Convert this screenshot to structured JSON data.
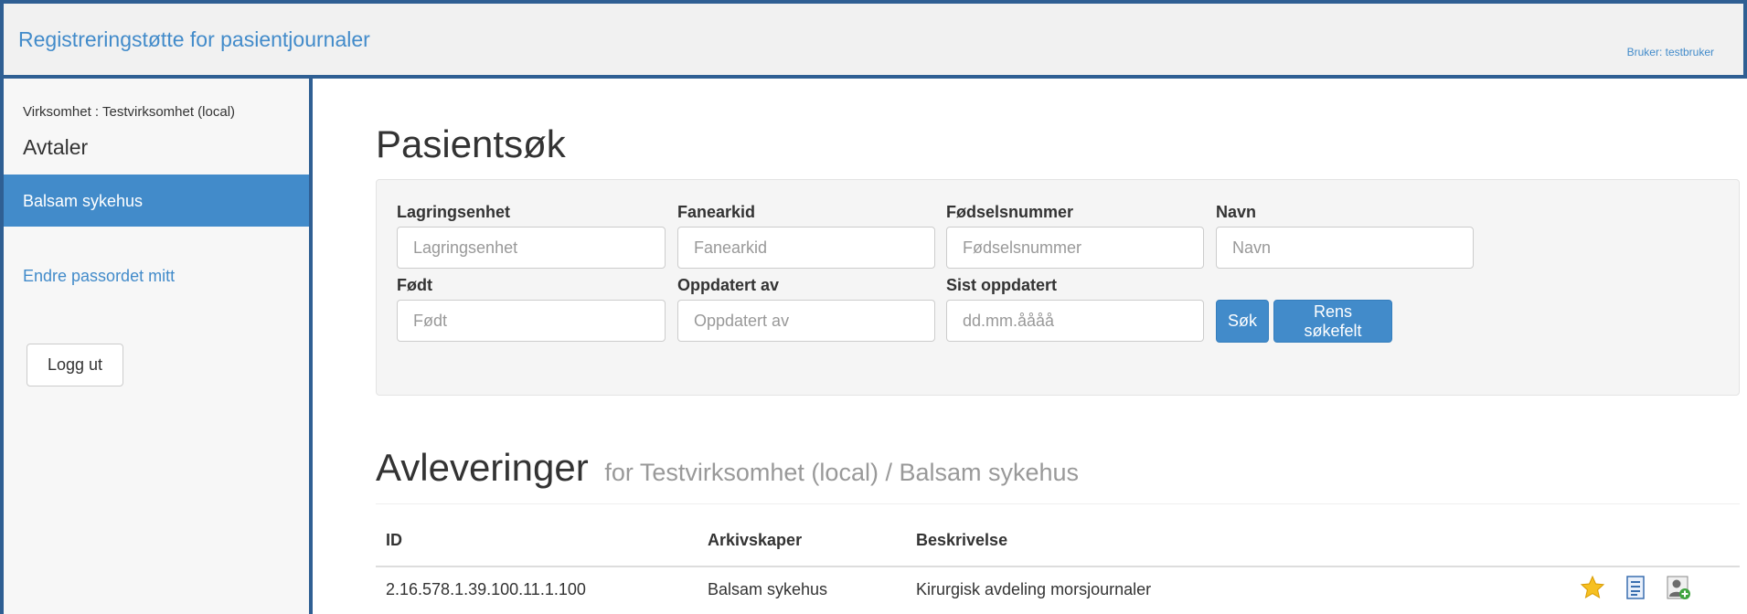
{
  "header": {
    "title": "Registreringstøtte for pasientjournaler",
    "user": "Bruker: testbruker"
  },
  "sidebar": {
    "org": "Virksomhet : Testvirksomhet (local)",
    "heading": "Avtaler",
    "active_item": "Balsam sykehus",
    "change_password": "Endre passordet mitt",
    "logout": "Logg ut"
  },
  "search": {
    "title": "Pasientsøk",
    "fields": {
      "lagringsenhet": {
        "label": "Lagringsenhet",
        "placeholder": "Lagringsenhet",
        "value": ""
      },
      "fanearkid": {
        "label": "Fanearkid",
        "placeholder": "Fanearkid",
        "value": ""
      },
      "fodselsnummer": {
        "label": "Fødselsnummer",
        "placeholder": "Fødselsnummer",
        "value": ""
      },
      "navn": {
        "label": "Navn",
        "placeholder": "Navn",
        "value": ""
      },
      "fodt": {
        "label": "Født",
        "placeholder": "Født",
        "value": ""
      },
      "oppdatert_av": {
        "label": "Oppdatert av",
        "placeholder": "Oppdatert av",
        "value": ""
      },
      "sist_oppdatert": {
        "label": "Sist oppdatert",
        "placeholder": "dd.mm.åååå",
        "value": ""
      }
    },
    "search_button": "Søk",
    "clear_button": "Rens søkefelt"
  },
  "deliveries": {
    "title": "Avleveringer",
    "subtitle": "for Testvirksomhet (local) / Balsam sykehus",
    "columns": [
      "ID",
      "Arkivskaper",
      "Beskrivelse"
    ],
    "rows": [
      {
        "id": "2.16.578.1.39.100.11.1.100",
        "arkivskaper": "Balsam sykehus",
        "beskrivelse": "Kirurgisk avdeling morsjournaler",
        "icons": [
          "star-icon",
          "document-icon",
          "add-user-icon"
        ]
      }
    ]
  },
  "colors": {
    "primary": "#428bca",
    "frame": "#2f5f93"
  }
}
